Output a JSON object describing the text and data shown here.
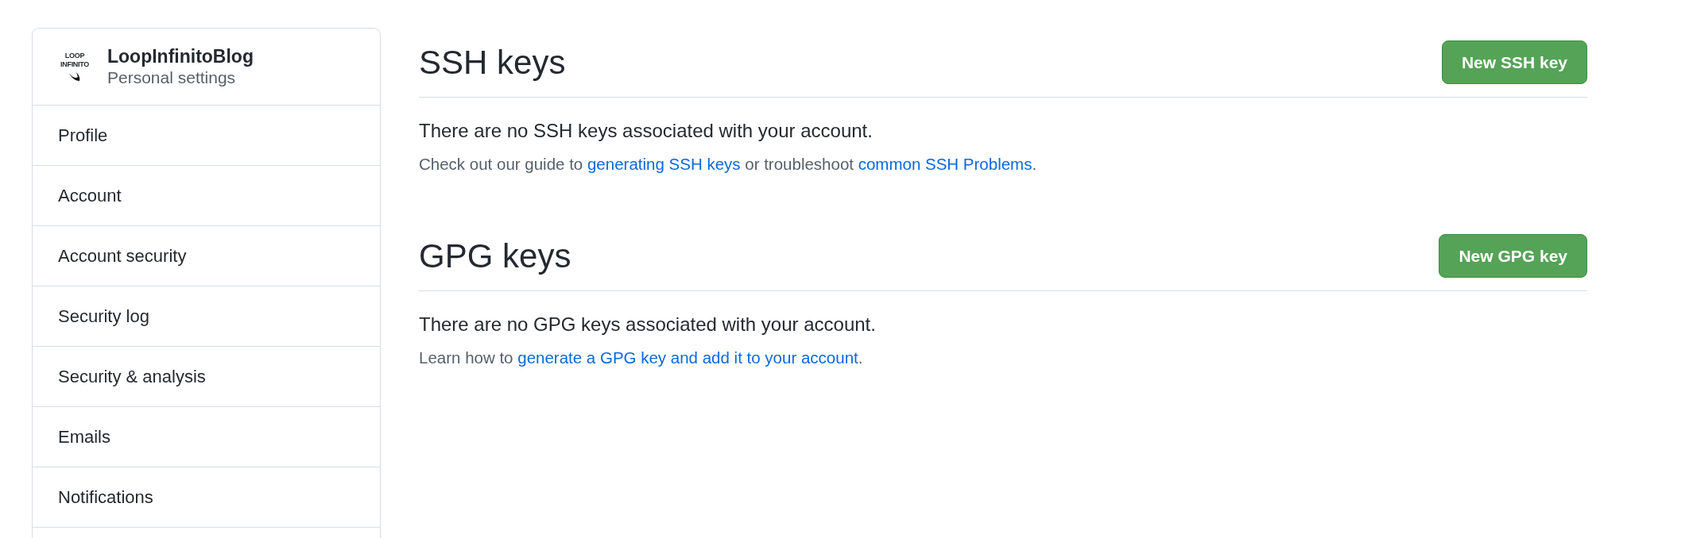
{
  "sidebar": {
    "logo": [
      "LOOP",
      "INFINITO"
    ],
    "name": "LoopInfinitoBlog",
    "subtitle": "Personal settings",
    "items": [
      {
        "label": "Profile"
      },
      {
        "label": "Account"
      },
      {
        "label": "Account security"
      },
      {
        "label": "Security log"
      },
      {
        "label": "Security & analysis"
      },
      {
        "label": "Emails"
      },
      {
        "label": "Notifications"
      }
    ]
  },
  "sections": [
    {
      "title": "SSH keys",
      "button": "New SSH key",
      "empty": "There are no SSH keys associated with your account.",
      "help": [
        {
          "kind": "text",
          "text": "Check out our guide to "
        },
        {
          "kind": "link",
          "text": "generating SSH keys"
        },
        {
          "kind": "text",
          "text": " or troubleshoot "
        },
        {
          "kind": "link",
          "text": "common SSH Problems"
        },
        {
          "kind": "text",
          "text": "."
        }
      ]
    },
    {
      "title": "GPG keys",
      "button": "New GPG key",
      "empty": "There are no GPG keys associated with your account.",
      "help": [
        {
          "kind": "text",
          "text": "Learn how to "
        },
        {
          "kind": "link",
          "text": "generate a GPG key and add it to your account"
        },
        {
          "kind": "text",
          "text": "."
        }
      ]
    }
  ]
}
